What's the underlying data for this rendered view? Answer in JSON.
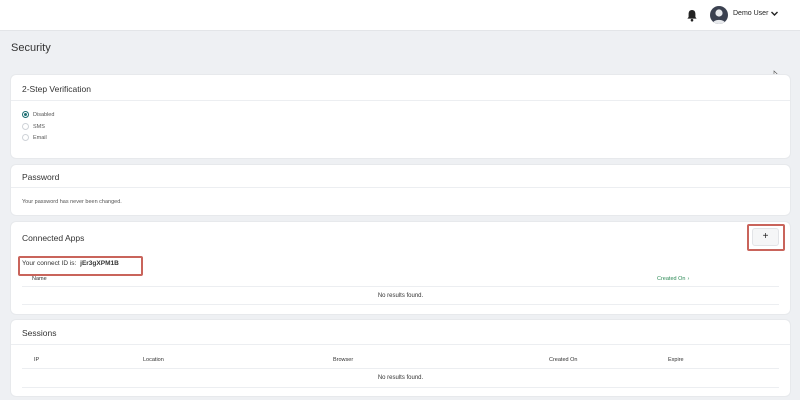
{
  "header": {
    "user_name": "Demo User",
    "icons": {
      "notifications": "bell-icon",
      "avatar": "user-avatar",
      "menu": "chevron-down-icon"
    }
  },
  "page": {
    "title": "Security"
  },
  "two_step": {
    "title": "2-Step Verification",
    "options": [
      {
        "label": "Disabled",
        "selected": true
      },
      {
        "label": "SMS",
        "selected": false
      },
      {
        "label": "Email",
        "selected": false
      }
    ]
  },
  "password": {
    "title": "Password",
    "status_text": "Your password has never been changed."
  },
  "connected_apps": {
    "title": "Connected Apps",
    "add_button_label": "+",
    "connect_id_label": "Your connect ID is:",
    "connect_id": "jEr3gXPM1B",
    "columns": {
      "name": "Name",
      "created_on": "Created On"
    },
    "sort_indicator": "›",
    "empty_text": "No results found."
  },
  "sessions": {
    "title": "Sessions",
    "columns": [
      "IP",
      "Location",
      "Browser",
      "Created On",
      "Expire"
    ],
    "empty_text": "No results found."
  },
  "colors": {
    "accent": "#1f6f73",
    "highlight": "#c9645b",
    "sort_link": "#2e8b57",
    "page_bg": "#eef0f3"
  }
}
